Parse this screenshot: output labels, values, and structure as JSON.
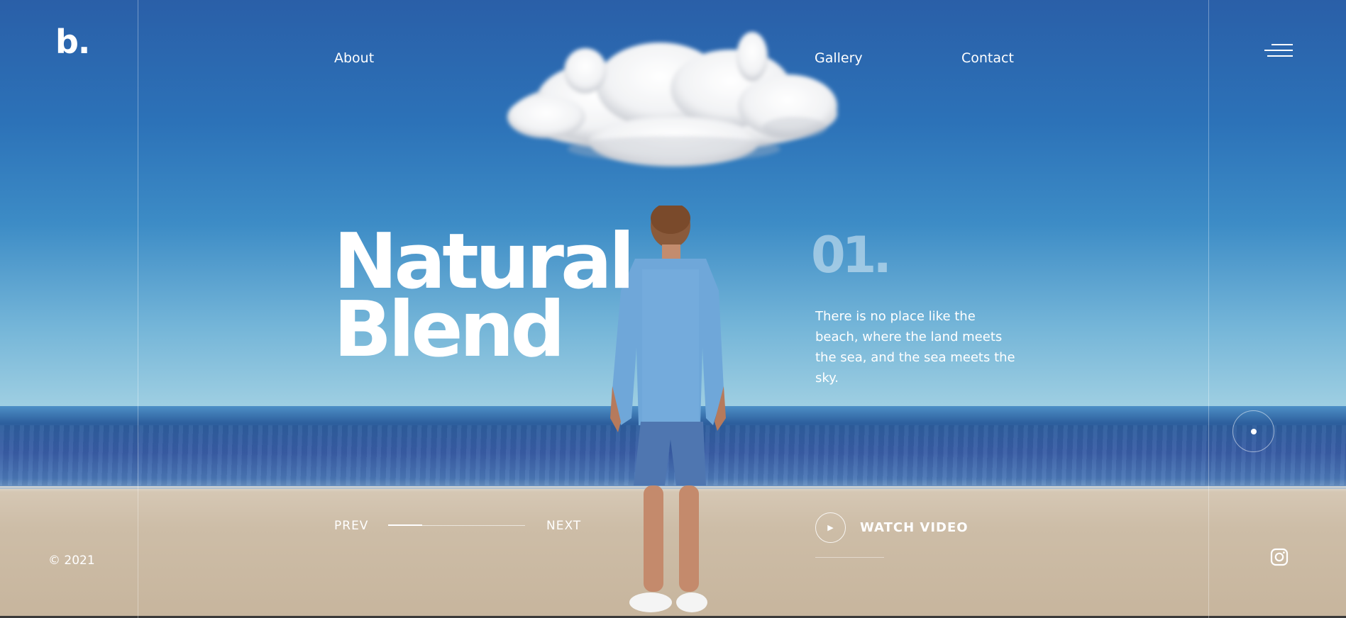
{
  "brand": {
    "logo": "b."
  },
  "nav": {
    "about": "About",
    "gallery": "Gallery",
    "contact": "Contact",
    "menu_icon": "hamburger-menu-icon"
  },
  "hero": {
    "title_line1": "Natural",
    "title_line2": "Blend",
    "slide_number": "01.",
    "tagline": "There is no place like the beach, where the land meets the sea, and the sea meets the sky."
  },
  "slider": {
    "prev": "PREV",
    "next": "NEXT",
    "progress": 0.25
  },
  "video": {
    "label": "WATCH VIDEO",
    "icon": "play-icon"
  },
  "footer": {
    "copyright": "© 2021",
    "social_icon": "instagram-icon"
  },
  "colors": {
    "sky_top": "#2a5fa8",
    "sky_horizon": "#9fcfe2",
    "sea": "#2d5f9d",
    "sand": "#cdbda7",
    "text": "#ffffff",
    "slide_number": "#c8e1f0"
  }
}
